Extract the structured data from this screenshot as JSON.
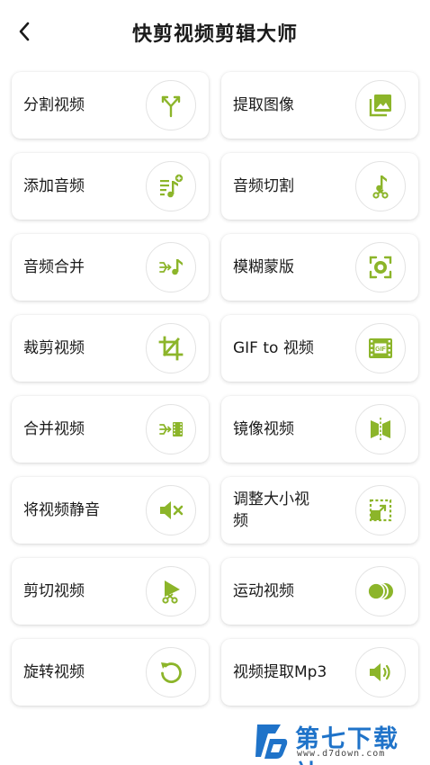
{
  "header": {
    "title": "快剪视频剪辑大师"
  },
  "accent": "#8cb52a",
  "tools": [
    {
      "label": "分割视频",
      "icon": "split-icon"
    },
    {
      "label": "提取图像",
      "icon": "image-extract-icon"
    },
    {
      "label": "添加音频",
      "icon": "add-audio-icon"
    },
    {
      "label": "音频切割",
      "icon": "audio-cut-icon"
    },
    {
      "label": "音频合并",
      "icon": "audio-merge-icon"
    },
    {
      "label": "模糊蒙版",
      "icon": "blur-mask-icon"
    },
    {
      "label": "裁剪视频",
      "icon": "crop-icon"
    },
    {
      "label": "GIF to 视频",
      "icon": "gif-icon"
    },
    {
      "label": "合并视频",
      "icon": "video-merge-icon"
    },
    {
      "label": "镜像视频",
      "icon": "mirror-icon"
    },
    {
      "label": "将视频静音",
      "icon": "mute-icon"
    },
    {
      "label": "调整大小视频",
      "icon": "resize-icon"
    },
    {
      "label": "剪切视频",
      "icon": "video-cut-icon"
    },
    {
      "label": "运动视频",
      "icon": "motion-icon"
    },
    {
      "label": "旋转视频",
      "icon": "rotate-icon"
    },
    {
      "label": "视频提取Mp3",
      "icon": "extract-mp3-icon"
    }
  ],
  "watermark": {
    "brand": "第七下载站",
    "url": "www.d7down.com"
  }
}
